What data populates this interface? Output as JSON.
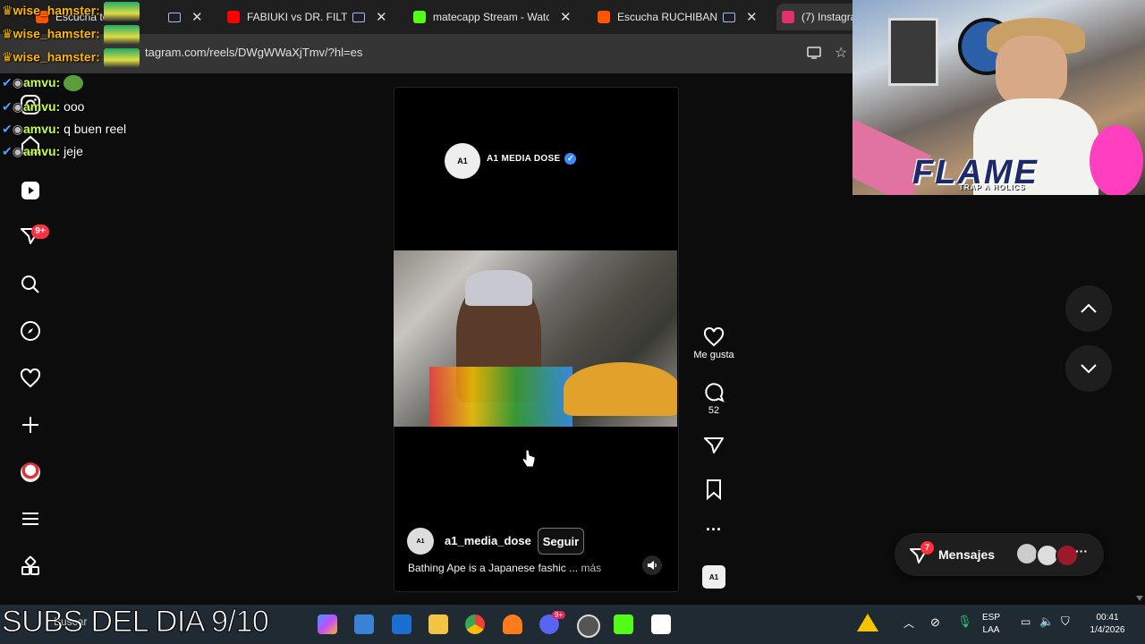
{
  "browser": {
    "tabs": [
      {
        "title": "Escucha to",
        "icon": "soundcloud-icon",
        "color": "#ff5500",
        "suffix": "n.mp",
        "x": 0
      },
      {
        "title": "FABIUKI vs DR. FILTROS",
        "icon": "youtube-icon",
        "color": "#ff0000"
      },
      {
        "title": "matecapp Stream - Watch Li",
        "icon": "kick-icon",
        "color": "#53fc18"
      },
      {
        "title": "Escucha RUCHIBANDZ (",
        "icon": "soundcloud-icon",
        "color": "#ff5500"
      },
      {
        "title": "(7) Instagram",
        "icon": "instagram-icon",
        "color": "#e1306c"
      }
    ],
    "url": "tagram.com/reels/DWgWWaXjTmv/?hl=es"
  },
  "chat": [
    {
      "user": "wise_hamster:",
      "text": ""
    },
    {
      "user": "wise_hamster:",
      "text": ""
    },
    {
      "user": "wise_hamster:",
      "text": ""
    },
    {
      "user": "amvu:",
      "text": ""
    },
    {
      "user": "amvu:",
      "text": "ooo"
    },
    {
      "user": "amvu:",
      "text": "q buen reel"
    },
    {
      "user": "amvu:",
      "text": "jeje"
    }
  ],
  "sidebar": {
    "notification_badge": "9+"
  },
  "reel": {
    "overlay_account": "A1 MEDIA DOSE",
    "account": "a1_media_dose",
    "follow_label": "Seguir",
    "caption": "Bathing Ape is a Japanese fashic ...",
    "more_label": "más",
    "likes_label": "Me gusta",
    "comments_count": "52"
  },
  "messages": {
    "label": "Mensajes",
    "badge": "7"
  },
  "webcam": {
    "title": "FLAME",
    "subtitle": "TRAP A HOLICS"
  },
  "overlay_text": "SUBS DEL DIA 9/10",
  "taskbar": {
    "search_placeholder": "Buscar",
    "language": "ESP",
    "layout": "LAA",
    "time": "00:41",
    "date": "1/4/2026",
    "discord_badge": "9+"
  }
}
